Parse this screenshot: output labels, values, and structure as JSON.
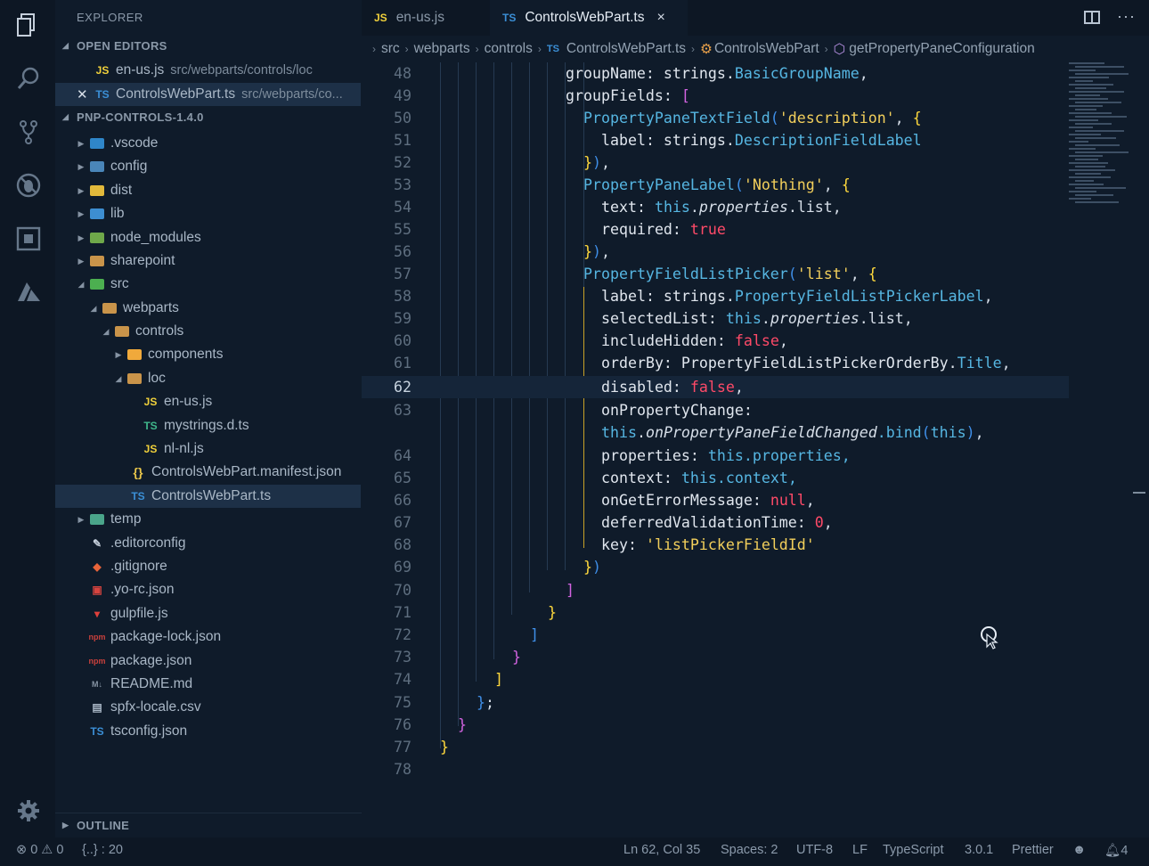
{
  "activity_bar": {
    "icons": [
      "explorer-icon",
      "search-icon",
      "source-control-icon",
      "debug-icon",
      "extensions-icon",
      "azure-icon",
      "settings-gear-icon"
    ]
  },
  "sidebar": {
    "title": "EXPLORER",
    "open_editors": {
      "label": "OPEN EDITORS",
      "items": [
        {
          "lang": "JS",
          "name": "en-us.js",
          "path": "src/webparts/controls/loc"
        },
        {
          "lang": "TS",
          "name": "ControlsWebPart.ts",
          "path": "src/webparts/co..."
        }
      ]
    },
    "project": {
      "label": "PNP-CONTROLS-1.4.0",
      "items": [
        {
          "name": ".vscode",
          "kind": "folder"
        },
        {
          "name": "config",
          "kind": "folder"
        },
        {
          "name": "dist",
          "kind": "folder"
        },
        {
          "name": "lib",
          "kind": "folder"
        },
        {
          "name": "node_modules",
          "kind": "folder"
        },
        {
          "name": "sharepoint",
          "kind": "folder"
        },
        {
          "name": "src",
          "kind": "folder"
        },
        {
          "name": "webparts",
          "kind": "folder"
        },
        {
          "name": "controls",
          "kind": "folder"
        },
        {
          "name": "components",
          "kind": "folder"
        },
        {
          "name": "loc",
          "kind": "folder"
        },
        {
          "name": "en-us.js",
          "kind": "JS"
        },
        {
          "name": "mystrings.d.ts",
          "kind": "TS"
        },
        {
          "name": "nl-nl.js",
          "kind": "JS"
        },
        {
          "name": "ControlsWebPart.manifest.json",
          "kind": "{}"
        },
        {
          "name": "ControlsWebPart.ts",
          "kind": "TS"
        },
        {
          "name": "temp",
          "kind": "folder"
        },
        {
          "name": ".editorconfig",
          "kind": "file"
        },
        {
          "name": ".gitignore",
          "kind": "file"
        },
        {
          "name": ".yo-rc.json",
          "kind": "file"
        },
        {
          "name": "gulpfile.js",
          "kind": "file"
        },
        {
          "name": "package-lock.json",
          "kind": "file"
        },
        {
          "name": "package.json",
          "kind": "file"
        },
        {
          "name": "README.md",
          "kind": "file"
        },
        {
          "name": "spfx-locale.csv",
          "kind": "file"
        },
        {
          "name": "tsconfig.json",
          "kind": "file"
        }
      ]
    },
    "outline_label": "OUTLINE"
  },
  "tabs": [
    {
      "lang": "JS",
      "label": "en-us.js",
      "active": false
    },
    {
      "lang": "TS",
      "label": "ControlsWebPart.ts",
      "active": true,
      "close": "×"
    }
  ],
  "breadcrumb": [
    "src",
    "webparts",
    "controls",
    "ControlsWebPart.ts",
    "ControlsWebPart",
    "getPropertyPaneConfiguration"
  ],
  "breadcrumb_lang": "TS",
  "editor": {
    "current_line": "62",
    "line_numbers": [
      "48",
      "49",
      "50",
      "51",
      "52",
      "53",
      "54",
      "55",
      "56",
      "57",
      "58",
      "59",
      "60",
      "61",
      "62",
      "63",
      "",
      "64",
      "65",
      "66",
      "67",
      "68",
      "69",
      "70",
      "71",
      "72",
      "73",
      "74",
      "75",
      "76",
      "77",
      "78"
    ]
  },
  "code": {
    "l48_a": "groupName: strings.",
    "l48_b": "BasicGroupName",
    "l48_c": ",",
    "l49_a": "groupFields: ",
    "l49_b": "[",
    "l50_a": "PropertyPaneTextField",
    "l50_b": "(",
    "l50_c": "'description'",
    "l50_d": ", ",
    "l50_e": "{",
    "l51_a": "label: strings.",
    "l51_b": "DescriptionFieldLabel",
    "l52_a": "}",
    "l52_b": ")",
    "l52_c": ",",
    "l53_a": "PropertyPaneLabel",
    "l53_b": "(",
    "l53_c": "'Nothing'",
    "l53_d": ", ",
    "l53_e": "{",
    "l54_a": "text: ",
    "l54_b": "this",
    "l54_c": ".",
    "l54_d": "properties",
    "l54_e": ".list,",
    "l55_a": "required: ",
    "l55_b": "true",
    "l56_a": "}",
    "l56_b": ")",
    "l56_c": ",",
    "l57_a": "PropertyFieldListPicker",
    "l57_b": "(",
    "l57_c": "'list'",
    "l57_d": ", ",
    "l57_e": "{",
    "l58_a": "label: strings.",
    "l58_b": "PropertyFieldListPickerLabel",
    "l58_c": ",",
    "l59_a": "selectedList: ",
    "l59_b": "this",
    "l59_c": ".",
    "l59_d": "properties",
    "l59_e": ".list,",
    "l60_a": "includeHidden: ",
    "l60_b": "false",
    "l60_c": ",",
    "l61_a": "orderBy: PropertyFieldListPickerOrderBy.",
    "l61_b": "Title",
    "l61_c": ",",
    "l62_a": "disabled: ",
    "l62_b": "false",
    "l62_c": ",",
    "l63_a": "onPropertyChange:",
    "l63w_a": "this",
    "l63w_b": ".",
    "l63w_c": "onPropertyPaneFieldChanged",
    "l63w_d": ".bind",
    "l63w_e": "(",
    "l63w_f": "this",
    "l63w_g": ")",
    "l63w_h": ",",
    "l64_a": "properties: ",
    "l64_b": "this",
    "l64_c": ".properties,",
    "l65_a": "context: ",
    "l65_b": "this",
    "l65_c": ".context,",
    "l66_a": "onGetErrorMessage: ",
    "l66_b": "null",
    "l66_c": ",",
    "l67_a": "deferredValidationTime: ",
    "l67_b": "0",
    "l67_c": ",",
    "l68_a": "key: ",
    "l68_b": "'listPickerFieldId'",
    "l69_a": "}",
    "l69_b": ")",
    "l70_a": "]",
    "l71_a": "}",
    "l72_a": "]",
    "l73_a": "}",
    "l74_a": "]",
    "l75_a": "}",
    "l75_b": ";",
    "l76_a": "}",
    "l77_a": "}"
  },
  "statusbar": {
    "errors": "0",
    "warnings": "0",
    "brackets": "{..} : 20",
    "position": "Ln 62, Col 35",
    "spaces": "Spaces: 2",
    "encoding": "UTF-8",
    "eol": "LF",
    "language": "TypeScript",
    "version": "3.0.1",
    "formatter": "Prettier",
    "notifications": "4"
  }
}
